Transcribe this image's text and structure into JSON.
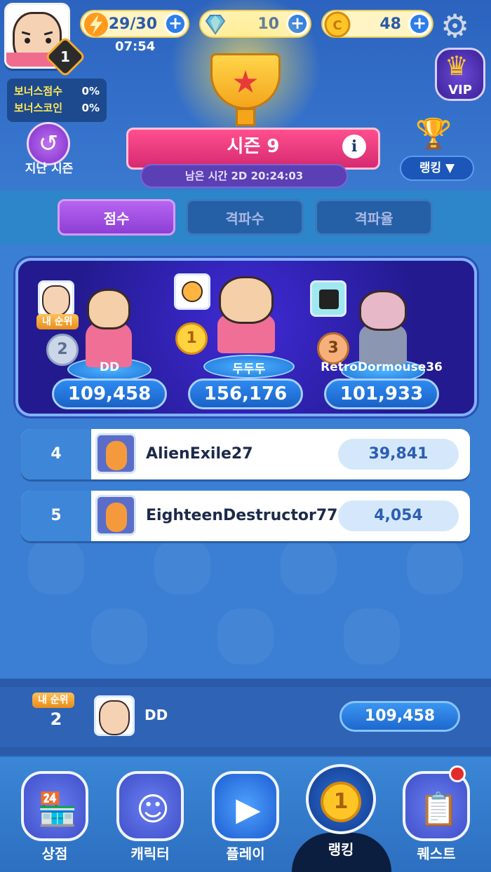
{
  "header": {
    "level": "1",
    "energy": "29/30",
    "gems": "10",
    "coins": "48",
    "timer": "07:54",
    "bonus": [
      {
        "label": "보너스점수",
        "value": "0%"
      },
      {
        "label": "보너스코인",
        "value": "0%"
      }
    ],
    "last_season_label": "지난 시즌",
    "vip_label": "VIP",
    "season_title": "시즌 9",
    "time_left": "남은 시간 2D 20:24:03",
    "ranking_dropdown": "랭킹 ▼"
  },
  "tabs": [
    {
      "label": "점수",
      "active": true
    },
    {
      "label": "격파수",
      "active": false
    },
    {
      "label": "격파율",
      "active": false
    }
  ],
  "podium": {
    "my_rank_tag": "내 순위",
    "first": {
      "rank": "1",
      "name": "두두두",
      "score": "156,176"
    },
    "second": {
      "rank": "2",
      "name": "DD",
      "score": "109,458"
    },
    "third": {
      "rank": "3",
      "name": "RetroDormouse36",
      "score": "101,933"
    }
  },
  "list": [
    {
      "rank": "4",
      "name": "AlienExile27",
      "score": "39,841"
    },
    {
      "rank": "5",
      "name": "EighteenDestructor77",
      "score": "4,054"
    }
  ],
  "my_rank": {
    "tag": "내 순위",
    "rank": "2",
    "name": "DD",
    "score": "109,458"
  },
  "nav": [
    {
      "label": "상점",
      "icon": "shop-icon"
    },
    {
      "label": "캐릭터",
      "icon": "character-icon"
    },
    {
      "label": "플레이",
      "icon": "play-icon"
    },
    {
      "label": "랭킹",
      "icon": "ranking-medal-icon",
      "active": true
    },
    {
      "label": "퀘스트",
      "icon": "quest-icon"
    }
  ],
  "colors": {
    "accent_purple": "#8d3fd5",
    "ribbon_pink": "#d62a71",
    "primary_blue": "#2f6fc4"
  }
}
